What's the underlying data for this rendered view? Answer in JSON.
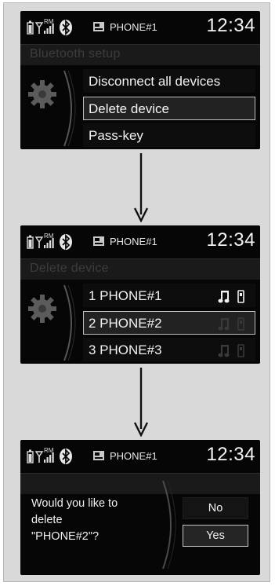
{
  "screens": [
    {
      "status": {
        "phone_name": "PHONE#1",
        "clock": "12:34",
        "rm_label": "RM"
      },
      "title": "Bluetooth setup",
      "items": [
        {
          "label": "Disconnect all devices"
        },
        {
          "label": "Delete device",
          "selected": true
        },
        {
          "label": "Pass-key"
        }
      ]
    },
    {
      "status": {
        "phone_name": "PHONE#1",
        "clock": "12:34",
        "rm_label": "RM"
      },
      "title": "Delete device",
      "items": [
        {
          "label": "1 PHONE#1",
          "icons": "bright"
        },
        {
          "label": "2 PHONE#2",
          "selected": true,
          "icons": "dim"
        },
        {
          "label": "3 PHONE#3",
          "icons": "dim"
        }
      ]
    },
    {
      "status": {
        "phone_name": "PHONE#1",
        "clock": "12:34",
        "rm_label": "RM"
      },
      "question": [
        "Would you like to",
        "delete",
        "\"PHONE#2\"?"
      ],
      "buttons": {
        "no": "No",
        "yes": "Yes",
        "selected": "yes"
      }
    }
  ],
  "icons": {
    "status": [
      "battery-icon",
      "signal-icon",
      "bluetooth-icon"
    ],
    "phone": "phone-icon",
    "menu": "gear-icon",
    "device": [
      "music-note-icon",
      "handset-icon"
    ],
    "flow": "down-arrow-icon"
  },
  "colors": {
    "screen_bg": "#060606",
    "title_text": "#3d3d3d",
    "panel_bg": "#d9d9d9",
    "selected_border": "#bfbfbf"
  }
}
